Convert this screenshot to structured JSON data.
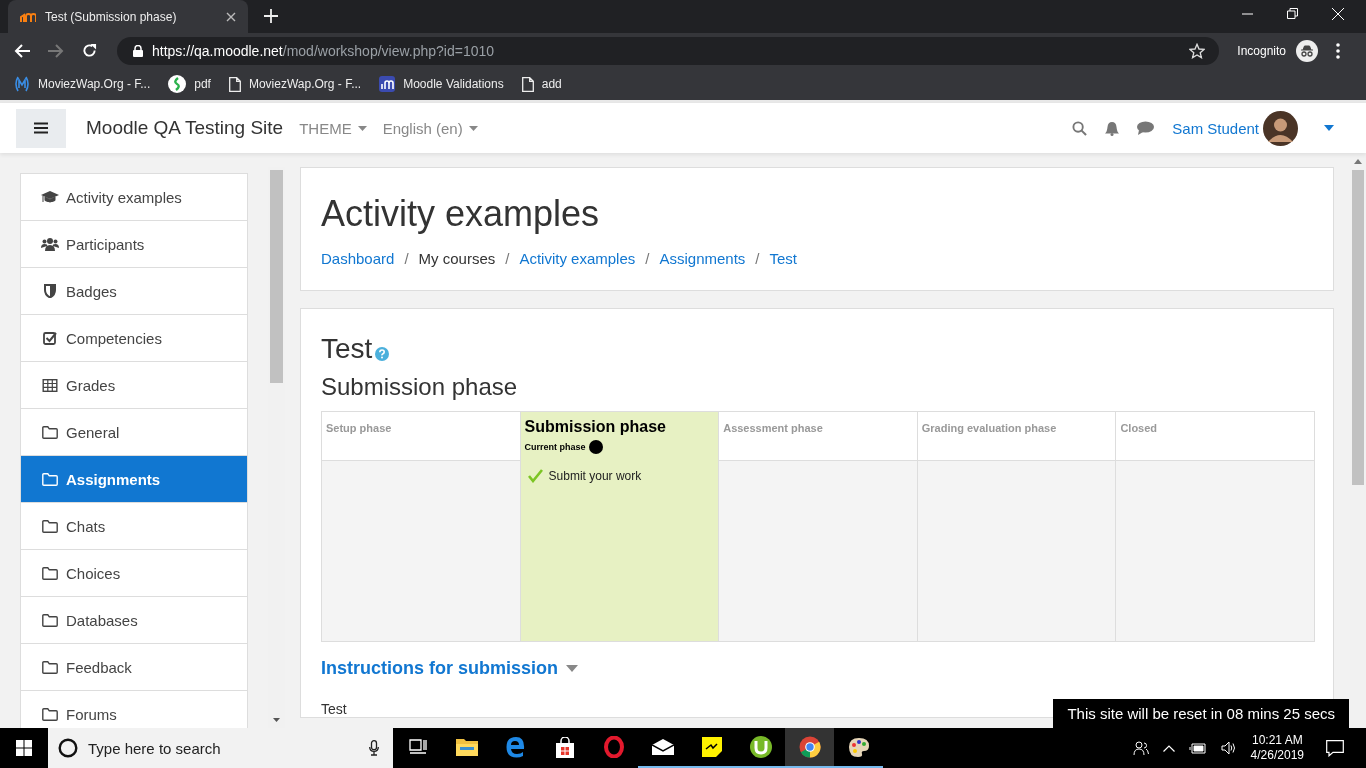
{
  "browser": {
    "tabs": [
      {
        "title": "Test (Submission phase)",
        "selected": true
      }
    ],
    "url": {
      "host": "https://qa.moodle.net",
      "path": "/mod/workshop/view.php?id=1010"
    },
    "profile": "Incognito",
    "bookmarks": [
      {
        "label": "MoviezWap.Org - F...",
        "kind": "m"
      },
      {
        "label": "pdf",
        "kind": "green"
      },
      {
        "label": "MoviezWap.Org - F...",
        "kind": "page"
      },
      {
        "label": "Moodle Validations",
        "kind": "moodle"
      },
      {
        "label": "add",
        "kind": "page"
      }
    ]
  },
  "site": {
    "name": "Moodle QA Testing Site",
    "menus": [
      "THEME",
      "English (en)"
    ],
    "user": "Sam Student"
  },
  "sidebar": {
    "items": [
      {
        "label": "Activity examples",
        "kind": "cap",
        "selected": false
      },
      {
        "label": "Participants",
        "kind": "users",
        "selected": false
      },
      {
        "label": "Badges",
        "kind": "shield",
        "selected": false
      },
      {
        "label": "Competencies",
        "kind": "check",
        "selected": false
      },
      {
        "label": "Grades",
        "kind": "table",
        "selected": false
      },
      {
        "label": "General",
        "kind": "folder",
        "selected": false
      },
      {
        "label": "Assignments",
        "kind": "folder",
        "selected": true
      },
      {
        "label": "Chats",
        "kind": "folder",
        "selected": false
      },
      {
        "label": "Choices",
        "kind": "folder",
        "selected": false
      },
      {
        "label": "Databases",
        "kind": "folder",
        "selected": false
      },
      {
        "label": "Feedback",
        "kind": "folder",
        "selected": false
      },
      {
        "label": "Forums",
        "kind": "folder",
        "selected": false
      }
    ]
  },
  "course": {
    "title": "Activity examples",
    "breadcrumb": [
      {
        "label": "Dashboard",
        "link": true
      },
      {
        "separator": "/"
      },
      {
        "label": "My courses",
        "link": false
      },
      {
        "separator": "/"
      },
      {
        "label": "Activity examples",
        "link": true
      },
      {
        "separator": "/"
      },
      {
        "label": "Assignments",
        "link": true
      },
      {
        "separator": "/"
      },
      {
        "label": "Test",
        "link": true
      }
    ]
  },
  "activity": {
    "title": "Test",
    "phase_heading": "Submission phase",
    "phases": [
      {
        "name": "Setup phase",
        "current": false
      },
      {
        "name": "Submission phase",
        "current": true,
        "current_label": "Current phase",
        "tasks": [
          {
            "label": "Submit your work",
            "done": true
          }
        ]
      },
      {
        "name": "Assessment phase",
        "current": false
      },
      {
        "name": "Grading evaluation phase",
        "current": false
      },
      {
        "name": "Closed",
        "current": false
      }
    ],
    "instructions_heading": "Instructions for submission",
    "instructions_text": "Test"
  },
  "notice": "This site will be reset in 08 mins 25 secs",
  "taskbar": {
    "search_placeholder": "Type here to search",
    "apps": [
      {
        "kind": "taskview",
        "running": false
      },
      {
        "kind": "explorer",
        "running": false
      },
      {
        "kind": "edge",
        "running": false
      },
      {
        "kind": "store",
        "running": false
      },
      {
        "kind": "opera",
        "running": false
      },
      {
        "kind": "mail",
        "running": true
      },
      {
        "kind": "sticky",
        "running": true
      },
      {
        "kind": "torrent",
        "running": true
      },
      {
        "kind": "chrome",
        "running": true,
        "active": true
      },
      {
        "kind": "paint",
        "running": true
      }
    ],
    "time": "10:21 AM",
    "date": "4/26/2019"
  }
}
